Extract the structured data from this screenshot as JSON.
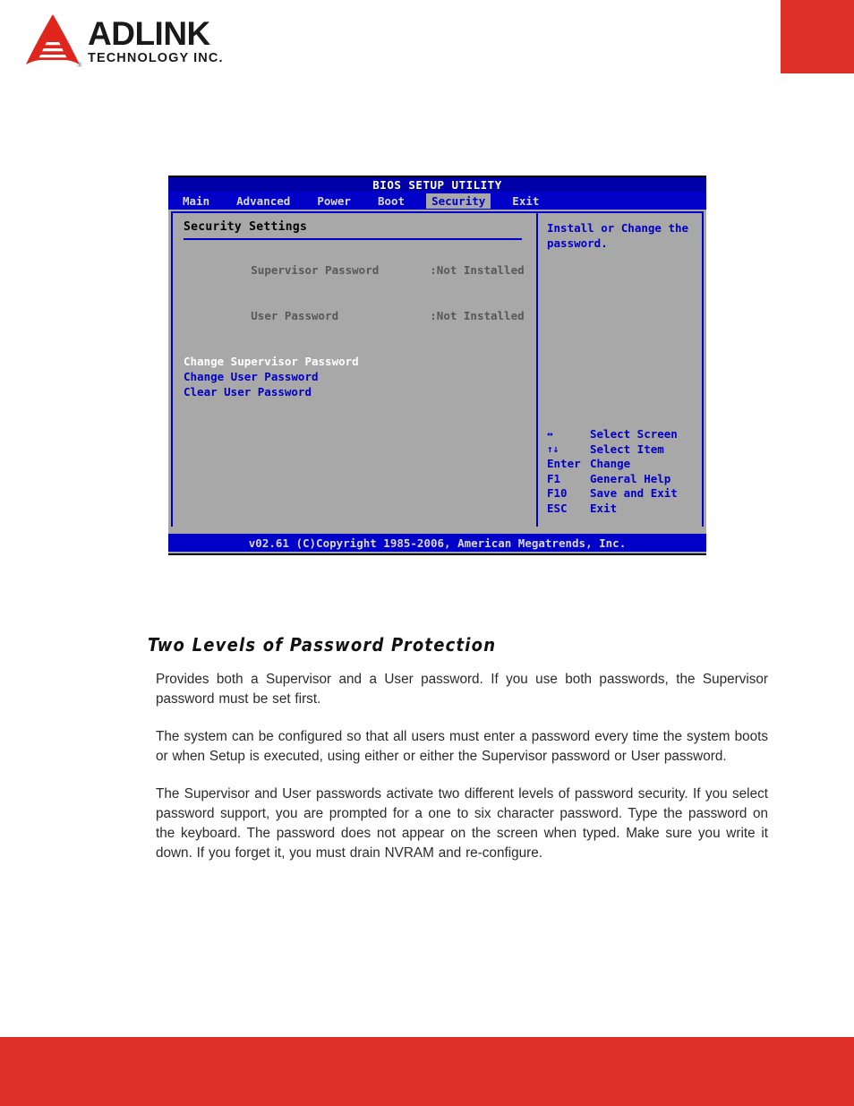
{
  "header": {
    "logo": {
      "brand": "ADLINK",
      "tagline": "TECHNOLOGY INC.",
      "registered_mark": "®",
      "mark_color": "#e0261c",
      "text_color": "#1a1a1a"
    },
    "accent_box_color": "#de2f26"
  },
  "bios": {
    "title": "BIOS SETUP UTILITY",
    "tabs": [
      {
        "label": "Main",
        "active": false
      },
      {
        "label": "Advanced",
        "active": false
      },
      {
        "label": "Power",
        "active": false
      },
      {
        "label": "Boot",
        "active": false
      },
      {
        "label": "Security",
        "active": true
      },
      {
        "label": "Exit",
        "active": false
      }
    ],
    "left_panel": {
      "heading": "Security Settings",
      "status_rows": [
        {
          "label": "Supervisor Password",
          "value": ":Not Installed"
        },
        {
          "label": "User Password",
          "value": ":Not Installed"
        }
      ],
      "options": [
        {
          "label": "Change Supervisor Password",
          "selected": true
        },
        {
          "label": "Change User Password",
          "selected": false
        },
        {
          "label": "Clear User Password",
          "selected": false
        }
      ]
    },
    "right_panel": {
      "help": "Install or Change the\npassword.",
      "legend": [
        {
          "key": "↔",
          "action": "Select Screen"
        },
        {
          "key": "↑↓",
          "action": "Select Item"
        },
        {
          "key": "Enter",
          "action": "Change"
        },
        {
          "key": "F1",
          "action": "General Help"
        },
        {
          "key": "F10",
          "action": "Save and Exit"
        },
        {
          "key": "ESC",
          "action": "Exit"
        }
      ]
    },
    "footer": "v02.61 (C)Copyright 1985-2006, American Megatrends, Inc.",
    "colors": {
      "panel_bg": "#a8a8a8",
      "blue": "#0000c8",
      "title_blue": "#0000a8",
      "selected_text": "#ffffff",
      "status_text": "#585858"
    }
  },
  "content": {
    "heading": "Two Levels of Password Protection",
    "paragraphs": [
      "Provides both a Supervisor and a User password. If you use both passwords, the Supervisor password must be set first.",
      "The system can be configured so that all users must enter a password every time the system boots or when Setup is executed, using either or either the Supervisor password or User password.",
      "The Supervisor and User passwords activate two different levels of password security. If you select password support, you are prompted for a one to six character password. Type the password on the keyboard. The password does not appear on the screen when typed. Make sure you write it down. If you forget it, you must drain NVRAM and re-configure."
    ]
  },
  "footer": {
    "bar_color": "#de2f26"
  }
}
